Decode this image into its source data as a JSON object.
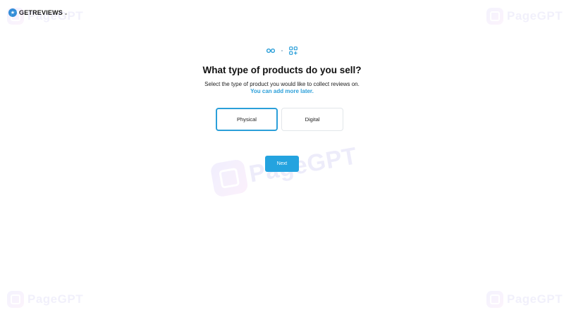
{
  "brand": {
    "name": "GETREVIEWS",
    "suffix": "ai"
  },
  "watermark": {
    "text": "PageGPT"
  },
  "steps": {
    "icons": [
      "link-icon",
      "apps-add-icon"
    ],
    "accent_color": "#2b9fd9"
  },
  "heading": {
    "title": "What type of products do you sell?",
    "subtitle": "Select the type of product you would like to collect reviews on.",
    "accent": "You can add more later."
  },
  "options": [
    {
      "label": "Physical",
      "selected": true
    },
    {
      "label": "Digital",
      "selected": false
    }
  ],
  "next_button": {
    "label": "Next",
    "color": "#24a3df"
  }
}
